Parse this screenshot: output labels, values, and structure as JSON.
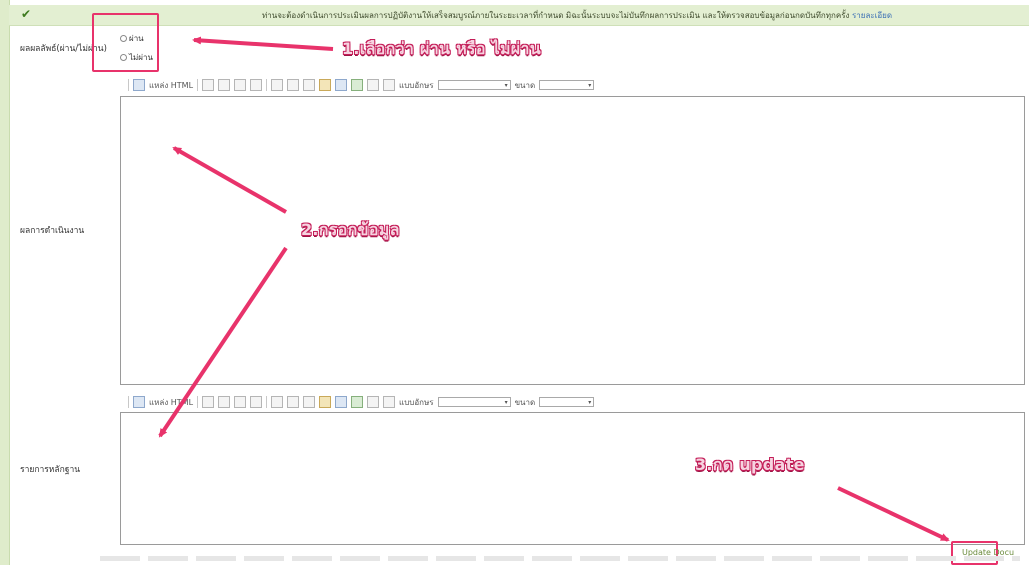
{
  "header": {
    "check_icon": "check-icon",
    "notice": "ท่านจะต้องดำเนินการประเมินผลการปฏิบัติงานให้เสร็จสมบูรณ์ภายในระยะเวลาที่กำหนด มิฉะนั้นระบบจะไม่บันทึกผลการประเมิน และให้ตรวจสอบข้อมูลก่อนกดบันทึกทุกครั้ง",
    "notice_link": "รายละเอียด"
  },
  "result_row": {
    "label": "ผลผลลัพธ์(ผ่าน/ไม่ผ่าน)",
    "options": [
      "ผ่าน",
      "ไม่ผ่าน"
    ]
  },
  "editor1": {
    "label": "ผลการดำเนินงาน",
    "toolbar": {
      "source_label": "แหล่ง HTML",
      "font_label": "แบบอักษร",
      "size_label": "ขนาด"
    }
  },
  "editor2": {
    "label": "รายการหลักฐาน",
    "toolbar": {
      "source_label": "แหล่ง HTML",
      "font_label": "แบบอักษร",
      "size_label": "ขนาด"
    }
  },
  "update_label": "Update Docu",
  "annotations": {
    "step1": "1.เลือกว่า ผ่าน หรือ ไม่ผ่าน",
    "step2": "2.กรอกข้อมูล",
    "step3": "3.กด update"
  },
  "colors": {
    "accent": "#e8336b",
    "header_bg": "#e3efd2"
  }
}
